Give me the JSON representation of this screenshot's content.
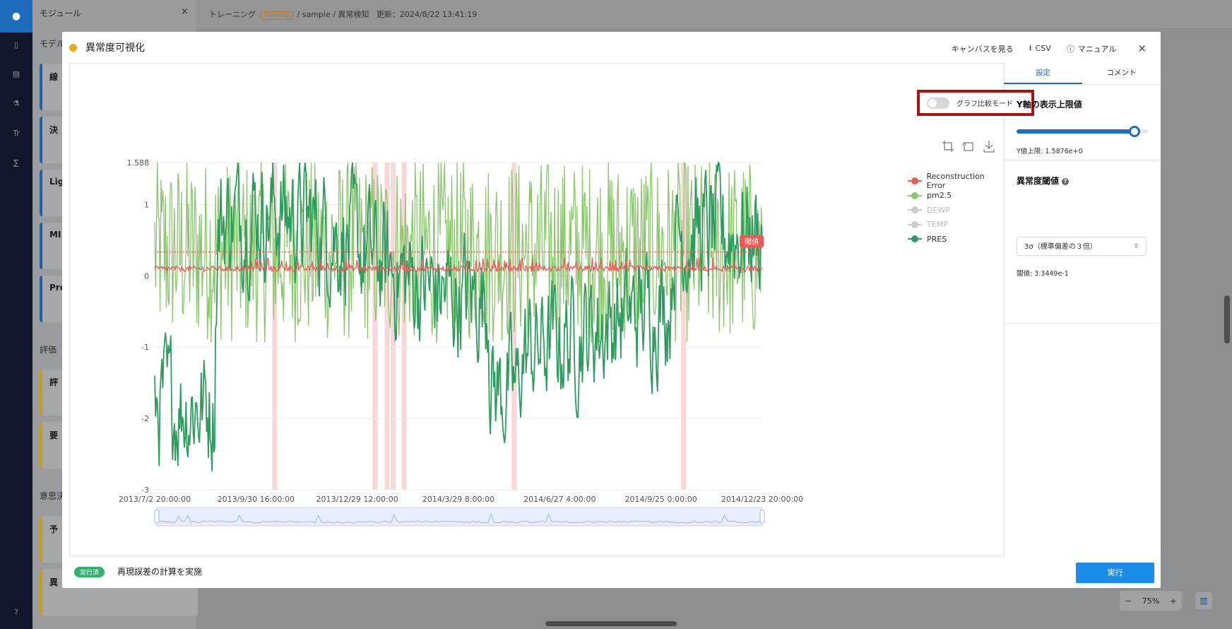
{
  "app": {
    "module_panel_title": "モジュール",
    "module_section": "モデル",
    "eval_section": "評価",
    "decision_section": "意思決",
    "cards": [
      "線",
      "決",
      "Lig",
      "MI",
      "Pro",
      "評",
      "要",
      "予",
      "異"
    ]
  },
  "breadcrumb": {
    "root": "トレーニング",
    "badge": "Training",
    "path": "/ sample / 異常検知",
    "updated": "更新：2024/8/22 13:41:19"
  },
  "zoom": {
    "minus": "−",
    "value": "75%",
    "plus": "+"
  },
  "modal": {
    "title": "異常度可視化",
    "actions": {
      "canvas": "キャンバスを見る",
      "csv": "CSV",
      "manual": "マニュアル"
    },
    "compare_toggle": {
      "label": "グラフ比較モード",
      "on": false
    },
    "tabs": [
      {
        "label": "設定",
        "active": true
      },
      {
        "label": "コメント",
        "active": false
      }
    ],
    "settings": {
      "y_section_title": "Y軸の表示上限値",
      "y_slider_fraction": 0.9,
      "y_limit_text": "Y値上限: 1.5876e+0",
      "threshold_title": "異常度閾値",
      "threshold_select": "3σ（標準偏差の３倍）",
      "threshold_text": "閾値: 3.3449e-1"
    },
    "footer": {
      "status_badge": "実行済",
      "status_text": "再現誤差の計算を実施",
      "run_button": "実行"
    }
  },
  "chart_data": {
    "type": "line",
    "ylim": [
      -3,
      1.588
    ],
    "y_ticks": [
      "1.588",
      "1",
      "0",
      "-1",
      "-2",
      "-3"
    ],
    "x_ticks": [
      "2013/7/2 20:00:00",
      "2013/9/30 16:00:00",
      "2013/12/29 12:00:00",
      "2014/3/29 8:00:00",
      "2014/6/27 4:00:00",
      "2014/9/25 0:00:00",
      "2014/12/23 20:00:00"
    ],
    "threshold": {
      "label": "閾値",
      "value": 0.33449
    },
    "anomaly_positions": [
      0.197,
      0.362,
      0.382,
      0.392,
      0.41,
      0.591,
      0.87
    ],
    "legend_position": "right",
    "series": [
      {
        "name": "Reconstruction Error",
        "color": "#e85c5c",
        "visible": true
      },
      {
        "name": "pm2.5",
        "color": "#8cc66e",
        "visible": true
      },
      {
        "name": "DEWP",
        "color": "#cccccc",
        "visible": false
      },
      {
        "name": "TEMP",
        "color": "#cccccc",
        "visible": false
      },
      {
        "name": "PRES",
        "color": "#2e9b5f",
        "visible": true
      }
    ]
  }
}
